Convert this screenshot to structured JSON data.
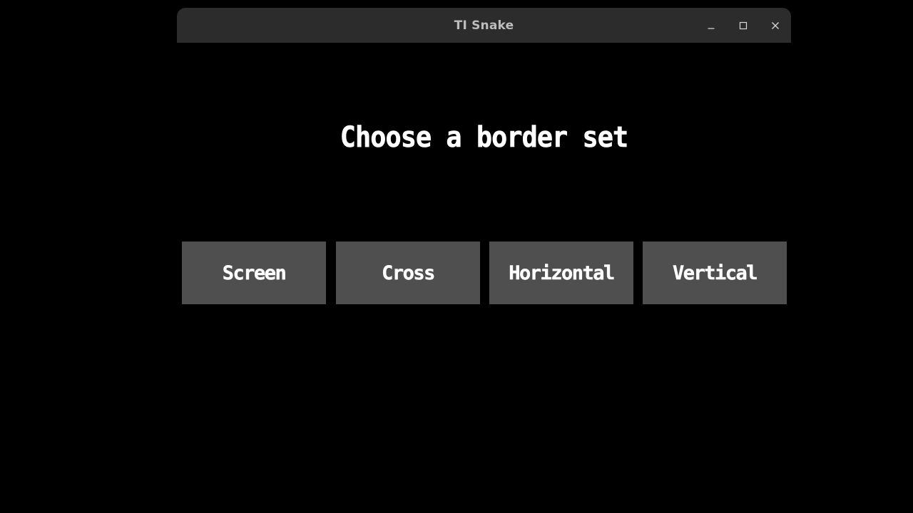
{
  "window": {
    "title": "TI Snake",
    "controls": {
      "minimize_icon": "minimize-icon",
      "maximize_icon": "maximize-icon",
      "close_icon": "close-icon"
    }
  },
  "screen": {
    "heading": "Choose a border set",
    "options": [
      {
        "label": "Screen"
      },
      {
        "label": "Cross"
      },
      {
        "label": "Horizontal"
      },
      {
        "label": "Vertical"
      }
    ]
  },
  "colors": {
    "background": "#000000",
    "titlebar": "#2c2c2c",
    "button": "#4f4f4f",
    "text": "#ffffff"
  }
}
